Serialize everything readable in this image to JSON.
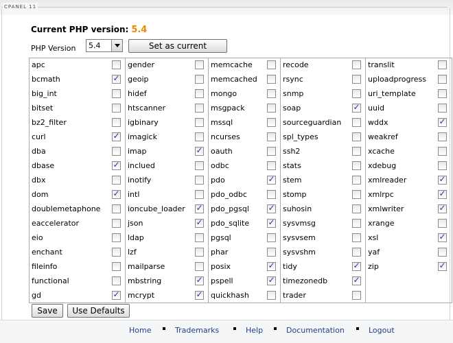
{
  "panel": {
    "legend": "CPANEL 11"
  },
  "current": {
    "label": "Current PHP version:",
    "version": "5.4"
  },
  "selector": {
    "label": "PHP Version",
    "value": "5.4",
    "set_current_label": "Set as current"
  },
  "columns": [
    [
      {
        "name": "apc",
        "checked": false
      },
      {
        "name": "bcmath",
        "checked": true
      },
      {
        "name": "big_int",
        "checked": false
      },
      {
        "name": "bitset",
        "checked": false
      },
      {
        "name": "bz2_filter",
        "checked": false
      },
      {
        "name": "curl",
        "checked": true
      },
      {
        "name": "dba",
        "checked": false
      },
      {
        "name": "dbase",
        "checked": true
      },
      {
        "name": "dbx",
        "checked": false
      },
      {
        "name": "dom",
        "checked": true
      },
      {
        "name": "doublemetaphone",
        "checked": false
      },
      {
        "name": "eaccelerator",
        "checked": false
      },
      {
        "name": "eio",
        "checked": false
      },
      {
        "name": "enchant",
        "checked": false
      },
      {
        "name": "fileinfo",
        "checked": false
      },
      {
        "name": "functional",
        "checked": false
      },
      {
        "name": "gd",
        "checked": true
      }
    ],
    [
      {
        "name": "gender",
        "checked": false
      },
      {
        "name": "geoip",
        "checked": false
      },
      {
        "name": "hidef",
        "checked": false
      },
      {
        "name": "htscanner",
        "checked": false
      },
      {
        "name": "igbinary",
        "checked": false
      },
      {
        "name": "imagick",
        "checked": false
      },
      {
        "name": "imap",
        "checked": true
      },
      {
        "name": "inclued",
        "checked": false
      },
      {
        "name": "inotify",
        "checked": false
      },
      {
        "name": "intl",
        "checked": false
      },
      {
        "name": "ioncube_loader",
        "checked": true
      },
      {
        "name": "json",
        "checked": true
      },
      {
        "name": "ldap",
        "checked": false
      },
      {
        "name": "lzf",
        "checked": false
      },
      {
        "name": "mailparse",
        "checked": false
      },
      {
        "name": "mbstring",
        "checked": true
      },
      {
        "name": "mcrypt",
        "checked": true
      }
    ],
    [
      {
        "name": "memcache",
        "checked": false
      },
      {
        "name": "memcached",
        "checked": false
      },
      {
        "name": "mongo",
        "checked": false
      },
      {
        "name": "msgpack",
        "checked": false
      },
      {
        "name": "mssql",
        "checked": false
      },
      {
        "name": "ncurses",
        "checked": false
      },
      {
        "name": "oauth",
        "checked": false
      },
      {
        "name": "odbc",
        "checked": false
      },
      {
        "name": "pdo",
        "checked": true
      },
      {
        "name": "pdo_odbc",
        "checked": false
      },
      {
        "name": "pdo_pgsql",
        "checked": true
      },
      {
        "name": "pdo_sqlite",
        "checked": true
      },
      {
        "name": "pgsql",
        "checked": false
      },
      {
        "name": "phar",
        "checked": false
      },
      {
        "name": "posix",
        "checked": true
      },
      {
        "name": "pspell",
        "checked": true
      },
      {
        "name": "quickhash",
        "checked": false
      }
    ],
    [
      {
        "name": "recode",
        "checked": false
      },
      {
        "name": "rsync",
        "checked": false
      },
      {
        "name": "snmp",
        "checked": false
      },
      {
        "name": "soap",
        "checked": true
      },
      {
        "name": "sourceguardian",
        "checked": false
      },
      {
        "name": "spl_types",
        "checked": false
      },
      {
        "name": "ssh2",
        "checked": false
      },
      {
        "name": "stats",
        "checked": false
      },
      {
        "name": "stem",
        "checked": false
      },
      {
        "name": "stomp",
        "checked": false
      },
      {
        "name": "suhosin",
        "checked": false
      },
      {
        "name": "sysvmsg",
        "checked": false
      },
      {
        "name": "sysvsem",
        "checked": false
      },
      {
        "name": "sysvshm",
        "checked": false
      },
      {
        "name": "tidy",
        "checked": true
      },
      {
        "name": "timezonedb",
        "checked": true
      },
      {
        "name": "trader",
        "checked": false
      }
    ],
    [
      {
        "name": "translit",
        "checked": false
      },
      {
        "name": "uploadprogress",
        "checked": false
      },
      {
        "name": "uri_template",
        "checked": false
      },
      {
        "name": "uuid",
        "checked": false
      },
      {
        "name": "wddx",
        "checked": true
      },
      {
        "name": "weakref",
        "checked": false
      },
      {
        "name": "xcache",
        "checked": false
      },
      {
        "name": "xdebug",
        "checked": false
      },
      {
        "name": "xmlreader",
        "checked": true
      },
      {
        "name": "xmlrpc",
        "checked": true
      },
      {
        "name": "xmlwriter",
        "checked": true
      },
      {
        "name": "xrange",
        "checked": false
      },
      {
        "name": "xsl",
        "checked": true
      },
      {
        "name": "yaf",
        "checked": false
      },
      {
        "name": "zip",
        "checked": true
      }
    ]
  ],
  "actions": {
    "save_label": "Save",
    "defaults_label": "Use Defaults"
  },
  "footer": {
    "links": [
      "Home",
      "Trademarks",
      "Help",
      "Documentation",
      "Logout"
    ]
  },
  "colors": {
    "version_accent": "#ee8800",
    "link": "#1d3f8a",
    "check": "#1a3fa4"
  }
}
